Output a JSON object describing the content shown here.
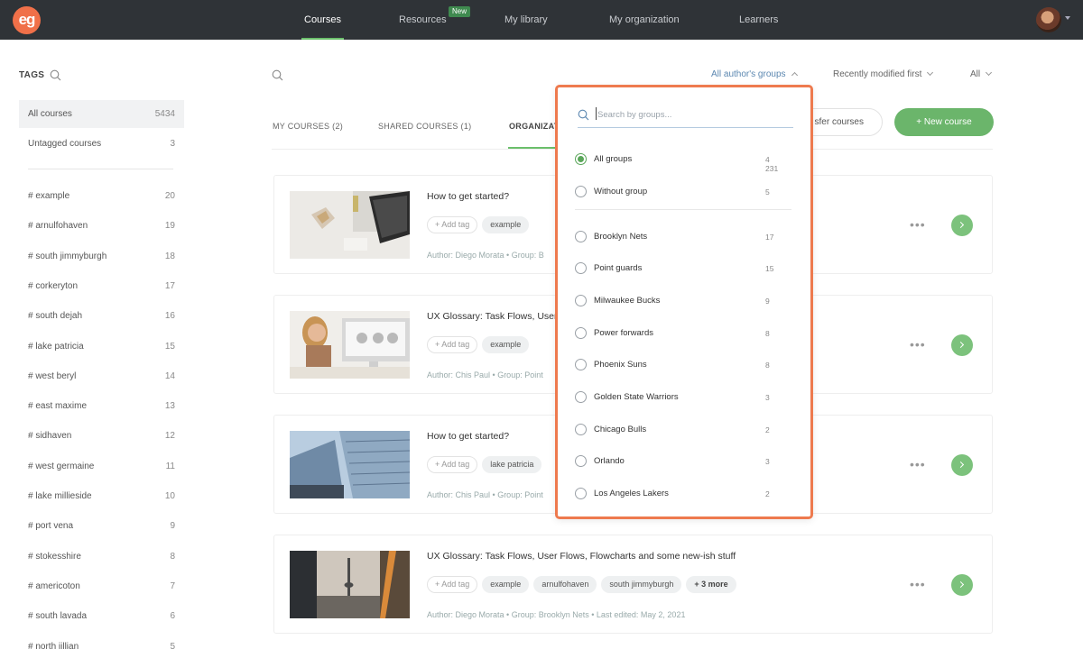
{
  "topbar": {
    "logo_text": "eg",
    "nav": [
      {
        "label": "Courses",
        "active": true
      },
      {
        "label": "Resources",
        "badge": "New"
      },
      {
        "label": "My library"
      },
      {
        "label": "My organization"
      },
      {
        "label": "Learners"
      }
    ]
  },
  "sidebar": {
    "title": "TAGS",
    "primary": [
      {
        "label": "All courses",
        "count": "5434"
      },
      {
        "label": "Untagged courses",
        "count": "3"
      }
    ],
    "tags": [
      {
        "label": "# example",
        "count": "20"
      },
      {
        "label": "# arnulfohaven",
        "count": "19"
      },
      {
        "label": "# south jimmyburgh",
        "count": "18"
      },
      {
        "label": "# corkeryton",
        "count": "17"
      },
      {
        "label": "# south dejah",
        "count": "16"
      },
      {
        "label": "# lake patricia",
        "count": "15"
      },
      {
        "label": "# west beryl",
        "count": "14"
      },
      {
        "label": "# east maxime",
        "count": "13"
      },
      {
        "label": "# sidhaven",
        "count": "12"
      },
      {
        "label": "# west germaine",
        "count": "11"
      },
      {
        "label": "# lake millieside",
        "count": "10"
      },
      {
        "label": "# port vena",
        "count": "9"
      },
      {
        "label": "# stokesshire",
        "count": "8"
      },
      {
        "label": "# americoton",
        "count": "7"
      },
      {
        "label": "# south lavada",
        "count": "6"
      },
      {
        "label": "# north jillian",
        "count": "5"
      }
    ]
  },
  "filters": {
    "groups": "All author's groups",
    "sort": "Recently modified first",
    "status": "All"
  },
  "tabs": [
    "MY COURSES (2)",
    "SHARED COURSES (1)",
    "ORGANIZAT"
  ],
  "actions": {
    "transfer": "sfer courses",
    "new_course": "+  New course"
  },
  "courses": [
    {
      "title": "How to get started?",
      "add_tag": "+ Add tag",
      "tags": [
        "example"
      ],
      "meta": "Author: Diego Morata  •  Group: B"
    },
    {
      "title": "UX Glossary: Task Flows, User",
      "add_tag": "+ Add tag",
      "tags": [
        "example"
      ],
      "meta": "Author: Chis Paul  •  Group: Point"
    },
    {
      "title": "How to get started?",
      "add_tag": "+ Add tag",
      "tags": [
        "lake patricia"
      ],
      "meta": "Author: Chis Paul  •  Group: Point"
    },
    {
      "title": "UX Glossary: Task Flows, User Flows, Flowcharts and some new-ish stuff",
      "add_tag": "+ Add tag",
      "tags": [
        "example",
        "arnulfohaven",
        "south jimmyburgh"
      ],
      "more": "+ 3 more",
      "meta": "Author: Diego Morata  •  Group: Brooklyn Nets  •  Last edited: May 2, 2021"
    }
  ],
  "group_dropdown": {
    "search_placeholder": "Search by groups...",
    "options": [
      {
        "name": "All groups",
        "count": "4 231",
        "checked": true
      },
      {
        "name": "Without group",
        "count": "5"
      },
      {
        "name": "Brooklyn Nets",
        "count": "17"
      },
      {
        "name": "Point guards",
        "count": "15"
      },
      {
        "name": "Milwaukee Bucks",
        "count": "9"
      },
      {
        "name": "Power forwards",
        "count": "8"
      },
      {
        "name": "Phoenix Suns",
        "count": "8"
      },
      {
        "name": "Golden State Warriors",
        "count": "3"
      },
      {
        "name": "Chicago Bulls",
        "count": "2"
      },
      {
        "name": "Orlando",
        "count": "3"
      },
      {
        "name": "Los Angeles Lakers",
        "count": "2"
      }
    ]
  },
  "colors": {
    "topbar": "#2f3337",
    "accent_green": "#6bb56b",
    "dropdown_border": "#ee7a4e",
    "logo": "#f07049"
  }
}
